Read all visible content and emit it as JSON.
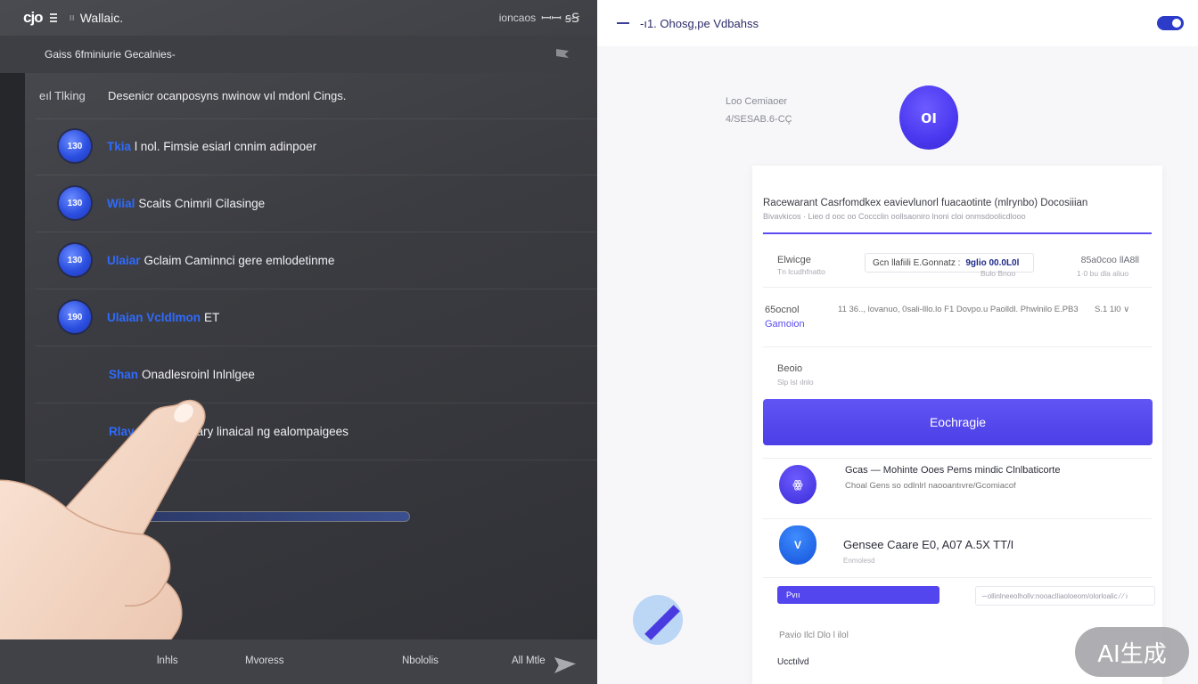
{
  "left": {
    "logo": "cjo",
    "separator": "ıı",
    "app_title": "Wallaic.",
    "top_right_label": "ioncaos",
    "top_right_icons": "ꟷꟷ ꞩꞨ",
    "subbar_text": "Gaiss 6fminiurie Gecalnies-",
    "list_header": {
      "col1": "eıl Tlking",
      "col2": "Desenicr ocanposyns nwinow vıl mdonl Cings."
    },
    "rows": [
      {
        "badge": "130",
        "accent": "Tkia",
        "text": "l nol. Fimsie esiarl cnnim adinpoer"
      },
      {
        "badge": "130",
        "accent": "Wiial",
        "text": "Scaits Cnimril Cilasinge"
      },
      {
        "badge": "130",
        "accent": "Ulaiar",
        "text": "Gclaim Caminnci gere emlodetinme"
      },
      {
        "badge": "190",
        "accent": "Ulaian Vcldlmon",
        "text": "ET"
      }
    ],
    "plain_rows": [
      {
        "accent": "Shan",
        "text": "Onadlesroinl Inlnlgee"
      },
      {
        "accent": "Rlay",
        "text": "al lisarr Kclary linaical ng ealompaigees"
      }
    ],
    "progress": 1.0,
    "bottom_tabs": [
      "lnhls",
      "Mvoress",
      "Nbololis",
      "All Mtle"
    ]
  },
  "right": {
    "header_title": "-ı1.  Ohosg,pe Vdbahss",
    "connection_label": "Loo Cemiaoer",
    "connection_value": "4/SESAB.6-CÇ",
    "avatar_text": "oı",
    "card": {
      "title": "Racewarant  Casrfomdkex eavievlunorl fuacaotinte (mlrynbo)  Docosiiian",
      "subtitle": "Bivavkicos  ·  Lieo d ooc oo Coccclin oollsaoniro lnoni cloi onmsdoolicdlooo",
      "field1_label": "Elwicge",
      "field1_hint": "Tn lcudhfnatto",
      "field1_input_prefix": "Gcn llafiili E.Gonnatz :",
      "field1_input_value": "9glio 00.0L0l",
      "field1_input_hint": "Bulo  Bnoo",
      "field1_amount": "85a0coo llA8ll",
      "field1_amount_hint": "1·0 bu dla aliuo",
      "field2_label": "65ocnol",
      "field2_label2": "Gamoion",
      "field2_text": "11 36.., lovanuo, 0sali-lllo.lo F1 Dovpo.u Paolldl. Phwlnilo E.PB3",
      "field2_right": "S.1 1l0  ∨",
      "field3_label": "Beoio",
      "field3_hint": "Slp lsl ılnlo",
      "button_label": "Eochragie",
      "items": [
        {
          "icon": "ꙮ",
          "title": "Gcas  —  Mohinte Ooes Pems mindic Clnlbaticorte",
          "sub": "Choal Gens so odlnlrl naooantıvre/Gcomiacof"
        },
        {
          "icon": "V",
          "title": "Gensee   Caare   E0, A07 A.5X  TT/I",
          "sub": "Enmolesd"
        }
      ],
      "pill_label": "Pvıı",
      "pill_note": "∽ollinlneeolhollv:nooaclliaoloeom/olorloalic  ⁄ ⁄ ı",
      "footer1": "Pavio  Ilcl Dlo l ilol",
      "footer2": "Ucctılvd"
    },
    "watermark": "AI生成"
  },
  "colors": {
    "accent_blue": "#2f6bff",
    "accent_purple": "#5446ee",
    "dark_bg": "#3b3c41",
    "light_bg": "#f7f7fa"
  }
}
